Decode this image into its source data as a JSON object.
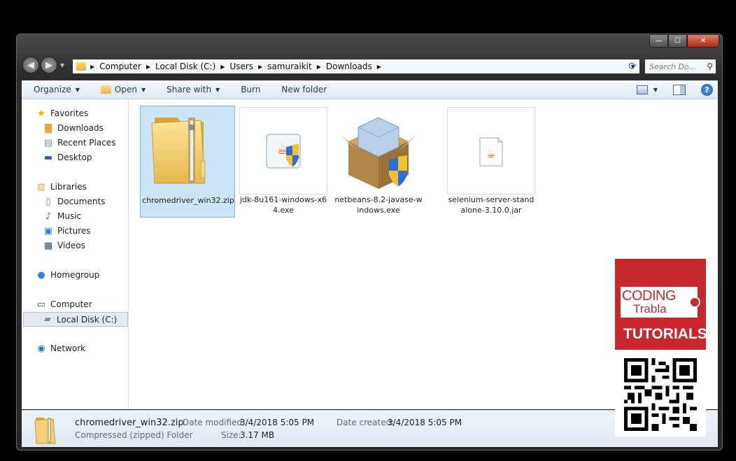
{
  "window": {
    "caption_buttons": {
      "minimize": "—",
      "maximize": "☐",
      "close": "✕"
    }
  },
  "nav": {
    "back": "◀",
    "forward": "▶"
  },
  "address": {
    "crumbs": [
      "Computer",
      "Local Disk (C:)",
      "Users",
      "samuraikit",
      "Downloads"
    ]
  },
  "search": {
    "placeholder": "Search Do..."
  },
  "toolbar": {
    "organize": "Organize",
    "open": "Open",
    "share_with": "Share with",
    "burn": "Burn",
    "new_folder": "New folder",
    "help": "?"
  },
  "sidebar": {
    "favorites": "Favorites",
    "downloads": "Downloads",
    "recent_places": "Recent Places",
    "desktop": "Desktop",
    "libraries": "Libraries",
    "documents": "Documents",
    "music": "Music",
    "pictures": "Pictures",
    "videos": "Videos",
    "homegroup": "Homegroup",
    "computer": "Computer",
    "local_disk": "Local Disk (C:)",
    "network": "Network"
  },
  "files": [
    {
      "name": "chromedriver_win32.zip",
      "icon": "zip-folder-icon"
    },
    {
      "name": "jdk-8u161-windows-x64.exe",
      "icon": "java-installer-icon"
    },
    {
      "name": "netbeans-8.2-javase-windows.exe",
      "icon": "installer-box-icon"
    },
    {
      "name": "selenium-server-standalone-3.10.0.jar",
      "icon": "jar-file-icon"
    }
  ],
  "details": {
    "file_name": "chromedriver_win32.zip",
    "file_type": "Compressed (zipped) Folder",
    "date_modified_label": "Date modified:",
    "date_modified": "3/4/2018 5:05 PM",
    "date_created_label": "Date created:",
    "date_created": "3/4/2018 5:05 PM",
    "size_label": "Size:",
    "size": "3.17 MB"
  },
  "watermark": {
    "coding": "CODING",
    "trabla": "Trabla",
    "tutorials": "TUTORIALS"
  }
}
